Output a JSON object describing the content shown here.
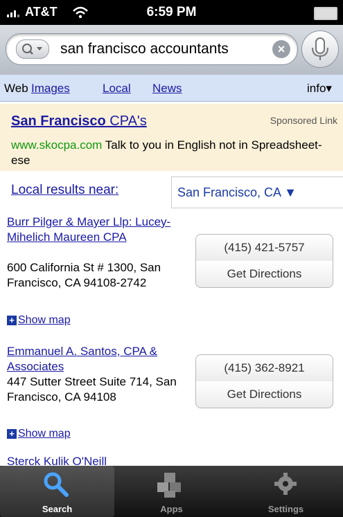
{
  "status_bar": {
    "carrier": "AT&T",
    "time": "6:59 PM"
  },
  "search": {
    "query": "san francisco accountants"
  },
  "tabs": [
    {
      "label": "Web"
    },
    {
      "label": "Images"
    },
    {
      "label": "Local"
    },
    {
      "label": "News"
    },
    {
      "label": "info▾"
    }
  ],
  "ad": {
    "title_bold": "San Francisco",
    "title_rest": " CPA's",
    "label": "Sponsored Link",
    "url": "www.skocpa.com",
    "text": " Talk to you in English not in Spreadsheet-ese"
  },
  "local": {
    "link": "Local results near:",
    "location": "San Francisco, CA ▼"
  },
  "results": [
    {
      "name": "Burr Pilger & Mayer Llp: Lucey-Mihelich Maureen CPA",
      "address": "600 California St # 1300, San Francisco, CA 94108-2742",
      "phone": "(415) 421-5757",
      "directions": "Get Directions",
      "show_map": "Show map"
    },
    {
      "name": "Emmanuel A. Santos, CPA & Associates",
      "address": "447 Sutter Street Suite 714, San Francisco, CA 94108",
      "phone": "(415) 362-8921",
      "directions": "Get Directions",
      "show_map": "Show map"
    }
  ],
  "partial_result": "Sterck Kulik O'Neill",
  "tab_bar": [
    {
      "label": "Search",
      "icon": "search-icon"
    },
    {
      "label": "Apps",
      "icon": "apps-icon"
    },
    {
      "label": "Settings",
      "icon": "gear-icon"
    }
  ]
}
